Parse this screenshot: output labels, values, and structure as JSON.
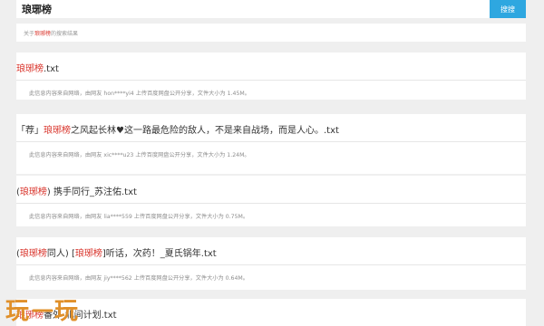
{
  "search": {
    "value": "琅琊榜",
    "button_label": "搜搜"
  },
  "summary": {
    "prefix": "关于",
    "keyword": "琅琊榜",
    "suffix": "的搜索结果"
  },
  "results": [
    {
      "title_parts": [
        {
          "text": "琅琊榜",
          "hl": true
        },
        {
          "text": ".txt",
          "hl": false
        }
      ],
      "desc": "此信息内容来自网络，由网友 hon****yi4 上传百度网盘公开分享，文件大小为 1.45M。"
    },
    {
      "title_parts": [
        {
          "text": "「荐」",
          "hl": false
        },
        {
          "text": "琅琊榜",
          "hl": true
        },
        {
          "text": "之风起长林♥这一路最危险的敌人，不是来自战场，而是人心。.txt",
          "hl": false
        }
      ],
      "desc": "此信息内容来自网络，由网友 xic****u23 上传百度网盘公开分享，文件大小为 1.24M。"
    },
    {
      "title_parts": [
        {
          "text": "(",
          "hl": false
        },
        {
          "text": "琅琊榜",
          "hl": true
        },
        {
          "text": ") 携手同行_苏注佑.txt",
          "hl": false
        }
      ],
      "desc": "此信息内容来自网络，由网友 lia****559 上传百度网盘公开分享，文件大小为 0.75M。"
    },
    {
      "title_parts": [
        {
          "text": "(",
          "hl": false
        },
        {
          "text": "琅琊榜",
          "hl": true
        },
        {
          "text": "同人) [",
          "hl": false
        },
        {
          "text": "琅琊榜",
          "hl": true
        },
        {
          "text": "]听话，次药！_夏氏锅年.txt",
          "hl": false
        }
      ],
      "desc": "此信息内容来自网络，由网友 jiy****562 上传百度网盘公开分享，文件大小为 0.64M。"
    },
    {
      "title_parts": [
        {
          "text": "琅琊榜",
          "hl": true
        },
        {
          "text": "番外-北间计划.txt",
          "hl": false
        }
      ],
      "desc": ""
    }
  ],
  "watermark": {
    "text": "玩一玩",
    "color": "#e0902a"
  },
  "colors": {
    "accent": "#2ea7e0",
    "highlight": "#d9342b"
  }
}
